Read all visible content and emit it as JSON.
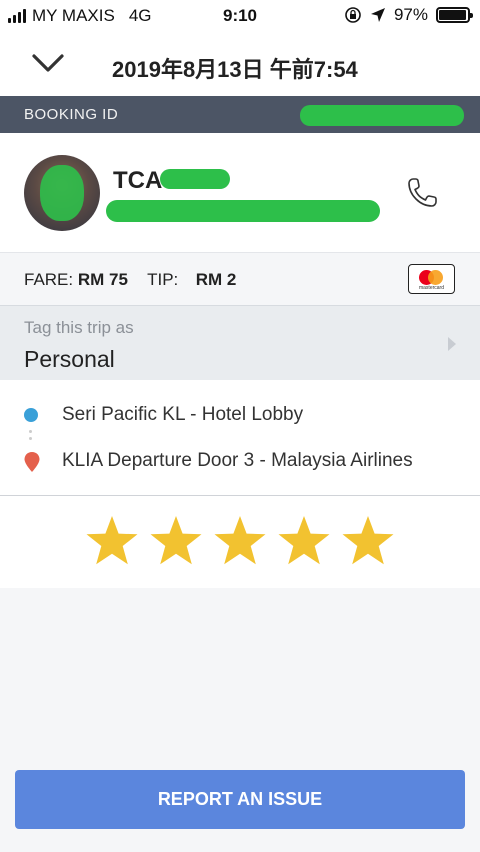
{
  "status_bar": {
    "carrier": "MY MAXIS",
    "network": "4G",
    "time": "9:10",
    "battery_percent": "97%",
    "battery_level": 0.97
  },
  "header": {
    "title": "2019年8月13日 午前7:54"
  },
  "booking": {
    "label": "BOOKING ID"
  },
  "driver": {
    "name_visible": "TCA"
  },
  "fare": {
    "fare_label": "FARE:",
    "fare_value": "RM 75",
    "tip_label": "TIP:",
    "tip_value": "RM 2",
    "card_brand": "mastercard"
  },
  "tag": {
    "label": "Tag this trip as",
    "value": "Personal"
  },
  "route": {
    "pickup": "Seri Pacific KL - Hotel Lobby",
    "dropoff": "KLIA Departure Door 3 - Malaysia Airlines"
  },
  "rating": {
    "stars": 5,
    "max": 5
  },
  "actions": {
    "report_label": "REPORT AN ISSUE"
  },
  "colors": {
    "primary_button": "#5b86dd",
    "booking_bar": "#4c5565",
    "star": "#f2c230",
    "pickup_dot": "#3aa0d8",
    "dropoff_pin": "#e4604c"
  }
}
